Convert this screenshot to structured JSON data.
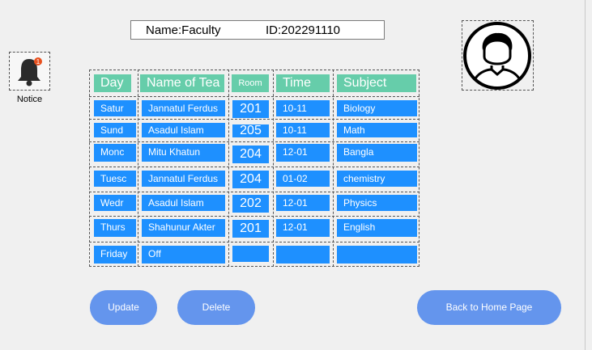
{
  "header": {
    "name": "Name:Faculty",
    "id": "ID:202291110"
  },
  "notice": {
    "label": "Notice",
    "badge_count": "1"
  },
  "table": {
    "headers": [
      "Day",
      "Name of Tea",
      "Room",
      "Time",
      "Subject"
    ],
    "rows": [
      [
        "Satur",
        "Jannatul Ferdus",
        "201",
        "10-11",
        "Biology"
      ],
      [
        "Sund",
        "Asadul Islam",
        "205",
        "10-11",
        "Math"
      ],
      [
        "Monc",
        "Mitu Khatun",
        "204",
        "12-01",
        "Bangla"
      ],
      [
        "Tuesc",
        "Jannatul Ferdus",
        "204",
        "01-02",
        "chemistry"
      ],
      [
        "Wedr",
        "Asadul Islam",
        "202",
        "12-01",
        "Physics"
      ],
      [
        "Thurs",
        "Shahunur Akter",
        "201",
        "12-01",
        "English"
      ],
      [
        "Friday",
        "Off",
        "",
        "",
        ""
      ]
    ]
  },
  "buttons": {
    "update": "Update",
    "delete": "Delete",
    "back": "Back to Home Page"
  },
  "colors": {
    "cell": "#1e90ff",
    "header": "#66cdaa",
    "button": "#6495ed",
    "badge": "#e8501e"
  }
}
